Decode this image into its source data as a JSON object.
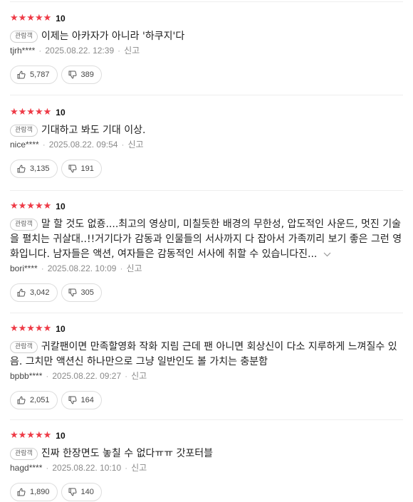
{
  "reviews": [
    {
      "stars": "★★★★★",
      "score": "10",
      "badge": "관람객",
      "text": "이제는 아카자가 아니라 '하쿠지'다",
      "author": "tjrh****",
      "date": "2025.08.22. 12:39",
      "report": "신고",
      "likes": "5,787",
      "dislikes": "389"
    },
    {
      "stars": "★★★★★",
      "score": "10",
      "badge": "관람객",
      "text": "기대하고 봐도 기대 이상.",
      "author": "nice****",
      "date": "2025.08.22. 09:54",
      "report": "신고",
      "likes": "3,135",
      "dislikes": "191"
    },
    {
      "stars": "★★★★★",
      "score": "10",
      "badge": "관람객",
      "text": "말 할 것도 없죵....최고의 영상미, 미칠듯한 배경의 무한성, 압도적인 사운드, 멋진 기술을 펼치는 귀살대..!!거기다가 감동과 인물들의 서사까지 다 잡아서 가족끼리 보기 좋은 그런 영화입니다. 남자들은 액션, 여자들은 감동적인 서사에 취할 수 있습니다진...",
      "expand_icon": "chevron-down",
      "author": "bori****",
      "date": "2025.08.22. 10:09",
      "report": "신고",
      "likes": "3,042",
      "dislikes": "305"
    },
    {
      "stars": "★★★★★",
      "score": "10",
      "badge": "관람객",
      "text": "귀칼팬이면 만족할영화 작화 지림 근데 팬 아니면 회상신이 다소 지루하게 느껴질수 있음. 그치만 액션신 하나만으로 그냥 일반인도 볼 가치는 충분함",
      "author": "bpbb****",
      "date": "2025.08.22. 09:27",
      "report": "신고",
      "likes": "2,051",
      "dislikes": "164"
    },
    {
      "stars": "★★★★★",
      "score": "10",
      "badge": "관람객",
      "text": "진짜 한장면도 놓칠 수 없다ㅠㅠ 갓포터블",
      "author": "hagd****",
      "date": "2025.08.22. 10:10",
      "report": "신고",
      "likes": "1,890",
      "dislikes": "140"
    }
  ],
  "colors": {
    "star": "#ee3a46",
    "meta": "#8a8a8a",
    "border": "#dddddd"
  }
}
